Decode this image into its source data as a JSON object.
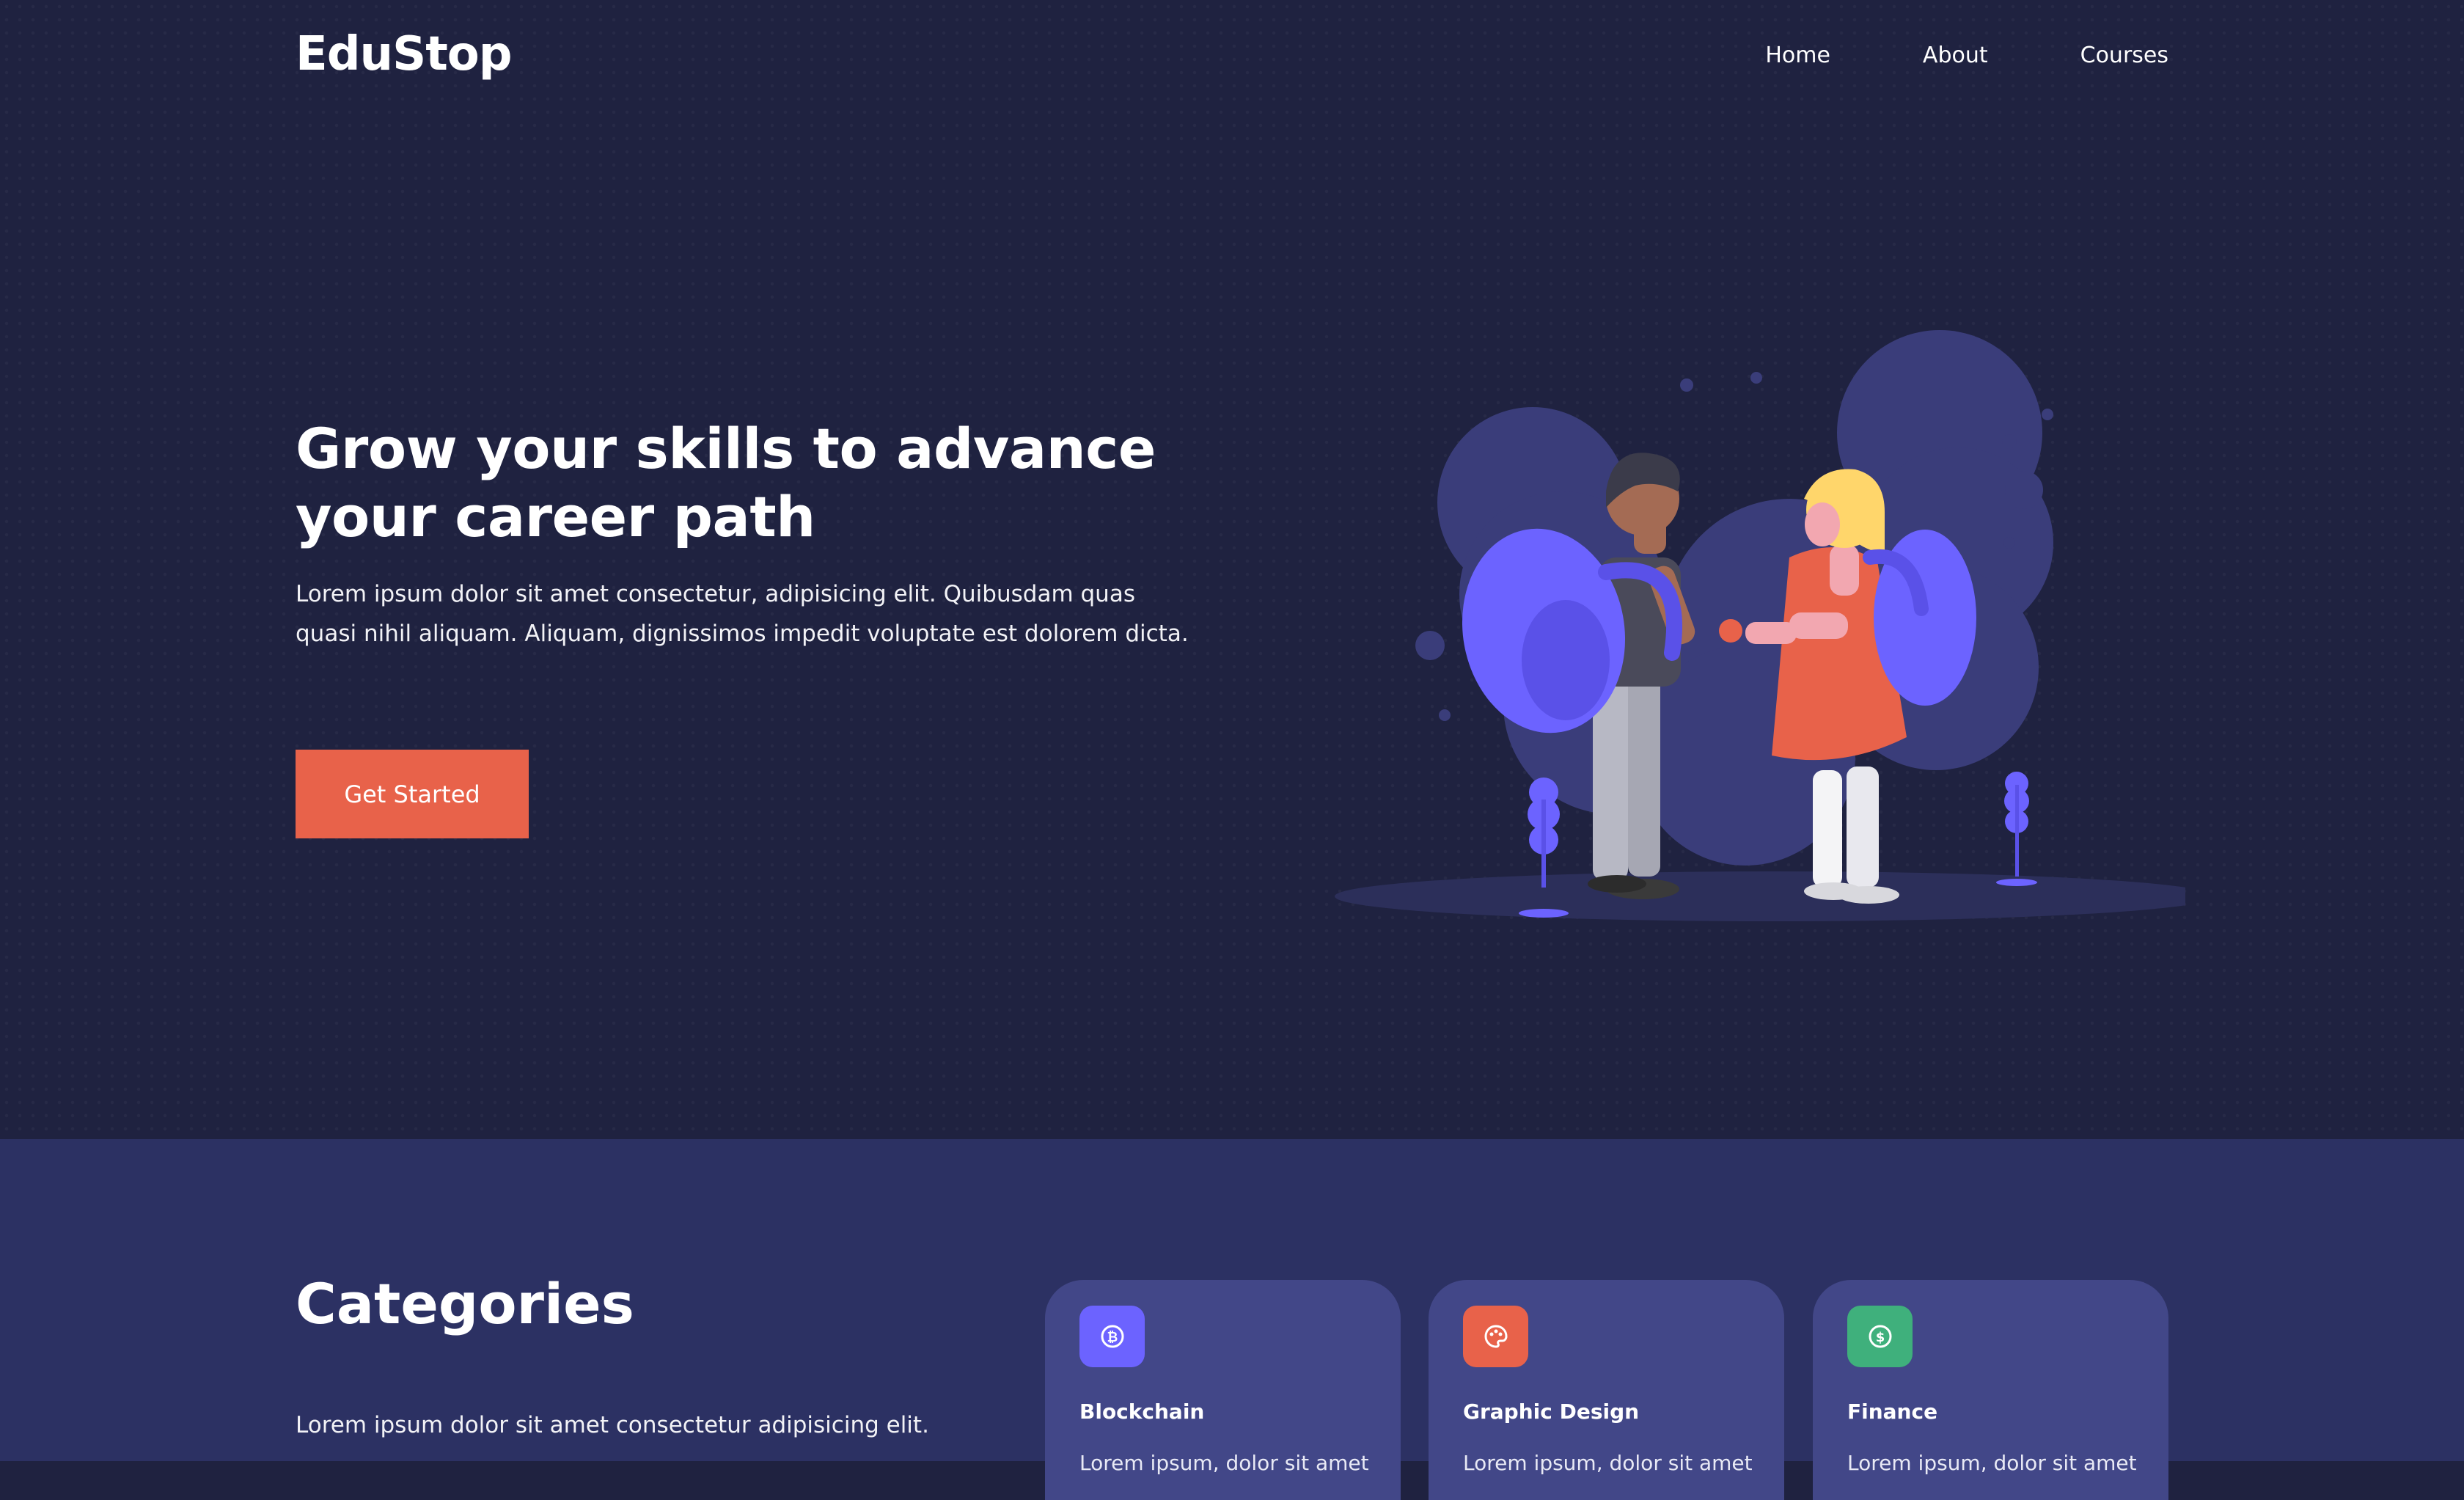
{
  "brand": {
    "name": "EduStop"
  },
  "nav": {
    "items": [
      {
        "label": "Home"
      },
      {
        "label": "About"
      },
      {
        "label": "Courses"
      }
    ]
  },
  "hero": {
    "title": "Grow your skills to advance your career path",
    "text": "Lorem ipsum dolor sit amet consectetur, adipisicing elit. Quibusdam quas quasi nihil aliquam. Aliquam, dignissimos impedit voluptate est dolorem dicta.",
    "cta_label": "Get Started"
  },
  "categories": {
    "title": "Categories",
    "text": "Lorem ipsum dolor sit amet consectetur adipisicing elit.",
    "cards": [
      {
        "name": "Blockchain",
        "icon": "bitcoin-icon",
        "color": "#6c63ff",
        "desc": "Lorem ipsum, dolor sit amet"
      },
      {
        "name": "Graphic Design",
        "icon": "palette-icon",
        "color": "#e8624a",
        "desc": "Lorem ipsum, dolor sit amet"
      },
      {
        "name": "Finance",
        "icon": "dollar-icon",
        "color": "#3fb07c",
        "desc": "Lorem ipsum, dolor sit amet"
      }
    ]
  },
  "colors": {
    "hero_bg": "#1f2240",
    "section_bg": "#2c3163",
    "card_bg": "#424788",
    "accent": "#e8624a",
    "purple": "#6c63ff"
  }
}
